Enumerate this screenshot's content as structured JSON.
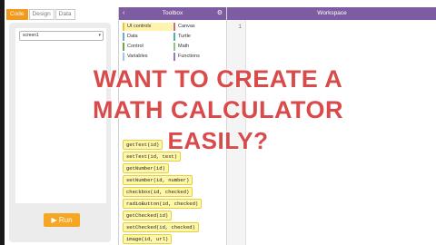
{
  "mode_tabs": [
    "Code",
    "Design",
    "Data"
  ],
  "screen_select": "screen1",
  "run_label": "Run",
  "toolbox": {
    "title": "Toolbox",
    "categories": [
      {
        "label": "UI controls",
        "color": "#f1c232",
        "active": true
      },
      {
        "label": "Canvas",
        "color": "#e06666"
      },
      {
        "label": "Data",
        "color": "#6fa8dc"
      },
      {
        "label": "Turtle",
        "color": "#45b6a8"
      },
      {
        "label": "Control",
        "color": "#6aa84f"
      },
      {
        "label": "Math",
        "color": "#93c47d"
      },
      {
        "label": "Variables",
        "color": "#9fc5e8"
      },
      {
        "label": "Functions",
        "color": "#8e7cc3"
      }
    ],
    "blocks": [
      "getText(id)",
      "setText(id, text)",
      "getNumber(id)",
      "setNumber(id, number)",
      "checkbox(id, checked)",
      "radioButton(id, checked)",
      "getChecked(id)",
      "setChecked(id, checked)",
      "image(id, url)"
    ]
  },
  "workspace": {
    "title": "Workspace",
    "line_number": "1"
  },
  "overlay": [
    "WANT TO CREATE A",
    "MATH CALCULATOR",
    "EASILY?"
  ]
}
